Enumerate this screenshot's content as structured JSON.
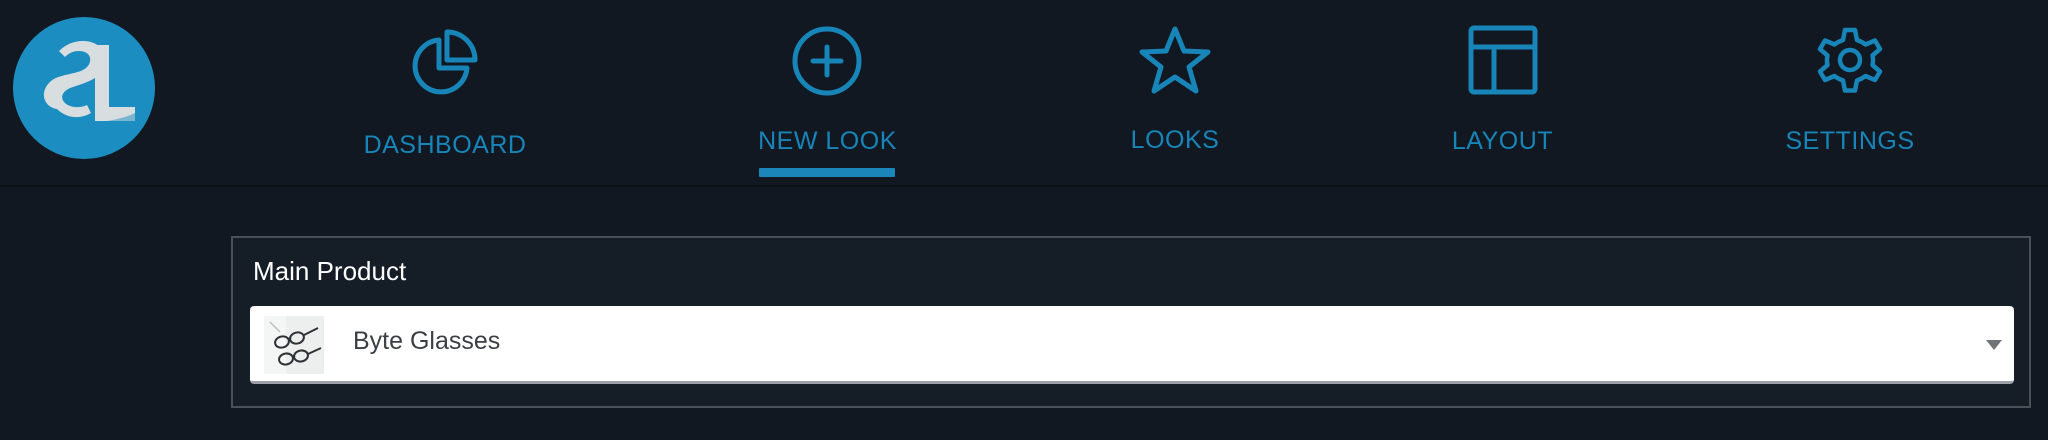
{
  "logo": {
    "text": "SL",
    "color": "#1b8dc0"
  },
  "nav": {
    "accent_color": "#1885b8",
    "active_item": "new-look",
    "items": [
      {
        "id": "dashboard",
        "label": "DASHBOARD",
        "icon": "pie-chart-icon"
      },
      {
        "id": "new-look",
        "label": "NEW LOOK",
        "icon": "plus-circle-icon"
      },
      {
        "id": "looks",
        "label": "LOOKS",
        "icon": "star-icon"
      },
      {
        "id": "layout",
        "label": "LAYOUT",
        "icon": "layout-icon"
      },
      {
        "id": "settings",
        "label": "SETTINGS",
        "icon": "gear-icon"
      }
    ]
  },
  "main_product": {
    "label": "Main Product",
    "selected": {
      "value": "Byte Glasses",
      "thumbnail": "glasses-thumbnail"
    }
  }
}
